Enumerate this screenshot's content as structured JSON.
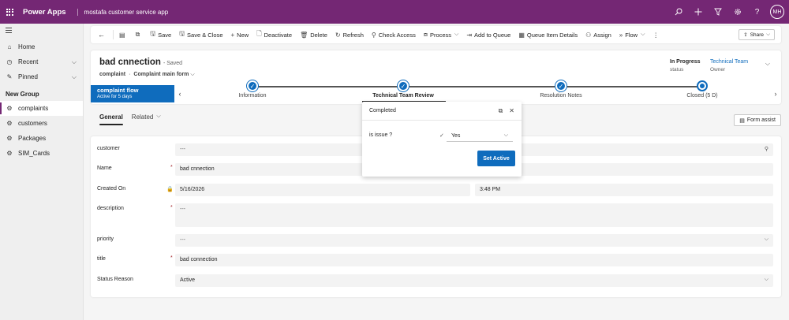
{
  "topbar": {
    "brand": "Power Apps",
    "app_name": "mostafa customer service app",
    "avatar_initials": "MH",
    "icons": [
      "search-icon",
      "plus-icon",
      "filter-icon",
      "gear-icon",
      "help-icon"
    ]
  },
  "sidebar": {
    "items": [
      {
        "label": "Home",
        "icon": "home-icon"
      },
      {
        "label": "Recent",
        "icon": "clock-icon",
        "expandable": true
      },
      {
        "label": "Pinned",
        "icon": "pin-icon",
        "expandable": true
      }
    ],
    "group_title": "New Group",
    "group_items": [
      {
        "label": "complaints",
        "icon": "entity-icon",
        "active": true
      },
      {
        "label": "customers",
        "icon": "entity-icon"
      },
      {
        "label": "Packages",
        "icon": "entity-icon"
      },
      {
        "label": "SIM_Cards",
        "icon": "entity-icon"
      }
    ]
  },
  "commandbar": {
    "items": [
      {
        "label": "Save",
        "icon": "save-icon"
      },
      {
        "label": "Save & Close",
        "icon": "save-close-icon"
      },
      {
        "label": "New",
        "icon": "plus-icon"
      },
      {
        "label": "Deactivate",
        "icon": "deactivate-icon"
      },
      {
        "label": "Delete",
        "icon": "trash-icon"
      },
      {
        "label": "Refresh",
        "icon": "refresh-icon"
      },
      {
        "label": "Check Access",
        "icon": "key-icon"
      },
      {
        "label": "Process",
        "icon": "process-icon",
        "dropdown": true
      },
      {
        "label": "Add to Queue",
        "icon": "queue-icon"
      },
      {
        "label": "Queue Item Details",
        "icon": "queue-details-icon"
      },
      {
        "label": "Assign",
        "icon": "person-icon"
      },
      {
        "label": "Flow",
        "icon": "flow-icon",
        "dropdown": true
      }
    ],
    "share_label": "Share"
  },
  "record": {
    "title": "bad cnnection",
    "saved_status": "- Saved",
    "entity": "complaint",
    "separator": "·",
    "form_name": "Complaint main form",
    "status_value": "In Progress",
    "status_label": "status",
    "owner_value": "Technical Team",
    "owner_label": "Owner"
  },
  "bpf": {
    "flag_title": "complaint flow",
    "flag_subtitle": "Active for 5 days",
    "stages": [
      {
        "label": "Information",
        "state": "completed"
      },
      {
        "label": "Technical Team Review",
        "state": "completed",
        "active": true
      },
      {
        "label": "Resolution Notes",
        "state": "completed"
      },
      {
        "label": "Closed  (5 D)",
        "state": "current"
      }
    ]
  },
  "tabs": [
    {
      "label": "General",
      "selected": true
    },
    {
      "label": "Related",
      "dropdown": true
    }
  ],
  "form_assist_label": "Form assist",
  "fields": [
    {
      "label": "customer",
      "value": "---",
      "required": false,
      "empty": true,
      "icon": "search-icon"
    },
    {
      "label": "Name",
      "value": "bad cnnection",
      "required": true
    },
    {
      "label": "Created On",
      "value": "5/16/2026",
      "time": "3:48 PM",
      "locked": true
    },
    {
      "label": "description",
      "value": "---",
      "required": true,
      "empty": true,
      "multiline": true
    },
    {
      "label": "priority",
      "value": "---",
      "empty": true,
      "dropdown": true
    },
    {
      "label": "title",
      "value": "bad connection",
      "required": true
    },
    {
      "label": "Status Reason",
      "value": "Active",
      "dropdown": true
    }
  ],
  "flyout": {
    "title": "Completed",
    "question": "is issue ?",
    "answer": "Yes",
    "button": "Set Active"
  },
  "colors": {
    "topbar": "#742774",
    "accent": "#0f6cbd",
    "required": "#a4262c"
  }
}
